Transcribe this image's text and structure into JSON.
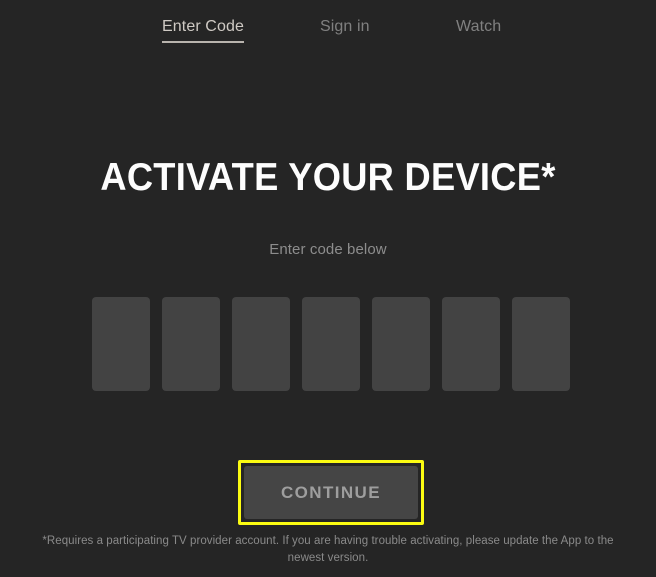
{
  "theme": {
    "background": "#252525",
    "box_fill": "#434343",
    "focus_ring": "#fbfb12",
    "active_tab_color": "#cfcac4",
    "inactive_tab_color": "#808080",
    "muted_text": "#8d8d8d",
    "heading_color": "#fdfdfd",
    "button_fill": "#454545",
    "button_text": "#9e9e9e"
  },
  "nav": {
    "tabs": [
      {
        "label": "Enter Code",
        "active": true
      },
      {
        "label": "Sign in",
        "active": false
      },
      {
        "label": "Watch",
        "active": false
      }
    ]
  },
  "main": {
    "heading": "ACTIVATE YOUR DEVICE*",
    "subtitle": "Enter code below",
    "code": {
      "length": 7,
      "values": [
        "",
        "",
        "",
        "",
        "",
        "",
        ""
      ],
      "placeholder": ""
    },
    "continue_label": "CONTINUE",
    "footnote": "*Requires a participating TV provider account. If you are having trouble activating, please update the App to the newest version."
  }
}
